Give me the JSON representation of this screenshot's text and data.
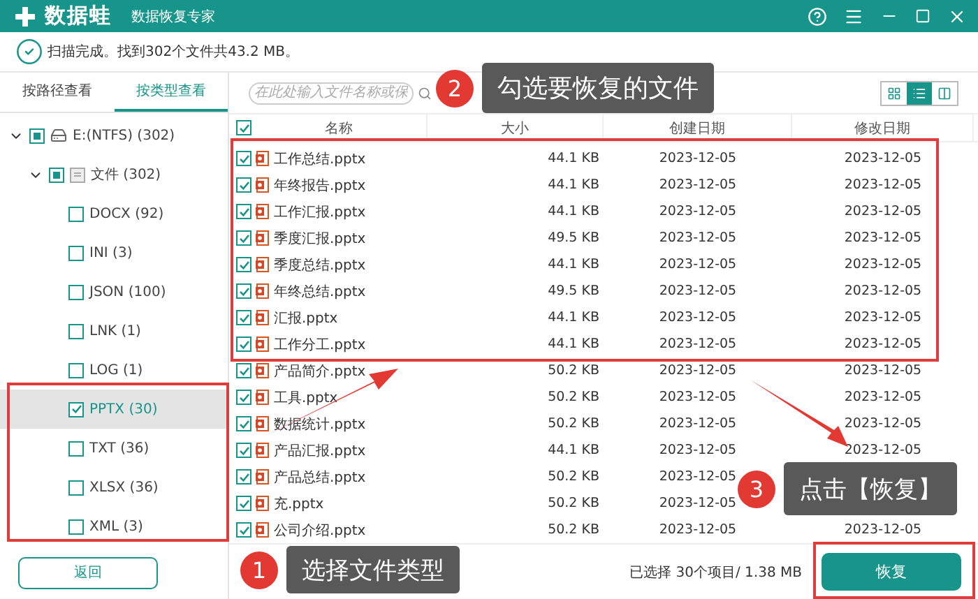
{
  "title_bar": {
    "app_name": "数据蛙",
    "subtitle": "数据恢复专家"
  },
  "status": "扫描完成。找到302个文件共43.2 MB。",
  "view_tabs": [
    {
      "label": "按路径查看",
      "selected": false
    },
    {
      "label": "按类型查看",
      "selected": true
    }
  ],
  "tree": [
    {
      "label": "E:(NTFS) (302)",
      "kind": "drive",
      "expanded": true,
      "partial": true,
      "selected": false,
      "children": [
        {
          "label": "文件 (302)",
          "kind": "folder",
          "expanded": true,
          "partial": true,
          "selected": false,
          "children": [
            {
              "label": "DOCX (92)",
              "checked": false,
              "selected": false
            },
            {
              "label": "INI (3)",
              "checked": false,
              "selected": false
            },
            {
              "label": "JSON (100)",
              "checked": false,
              "selected": false
            },
            {
              "label": "LNK (1)",
              "checked": false,
              "selected": false
            },
            {
              "label": "LOG (1)",
              "checked": false,
              "selected": false
            },
            {
              "label": "PPTX (30)",
              "checked": true,
              "selected": true
            },
            {
              "label": "TXT (36)",
              "checked": false,
              "selected": false
            },
            {
              "label": "XLSX (36)",
              "checked": false,
              "selected": false
            },
            {
              "label": "XML (3)",
              "checked": false,
              "selected": false
            }
          ]
        }
      ]
    }
  ],
  "search": {
    "placeholder": "在此处输入文件名称或保"
  },
  "view_modes": [
    {
      "kind": "grid",
      "selected": false
    },
    {
      "kind": "list",
      "selected": true
    },
    {
      "kind": "detail",
      "selected": false
    }
  ],
  "table": {
    "header_checked": true,
    "columns": [
      "名称",
      "大小",
      "创建日期",
      "修改日期"
    ],
    "rows": [
      {
        "name": "工作总结.pptx",
        "size": "44.1 KB",
        "created": "2023-12-05",
        "modified": "2023-12-05",
        "checked": true
      },
      {
        "name": "年终报告.pptx",
        "size": "44.1 KB",
        "created": "2023-12-05",
        "modified": "2023-12-05",
        "checked": true
      },
      {
        "name": "工作汇报.pptx",
        "size": "44.1 KB",
        "created": "2023-12-05",
        "modified": "2023-12-05",
        "checked": true
      },
      {
        "name": "季度汇报.pptx",
        "size": "49.5 KB",
        "created": "2023-12-05",
        "modified": "2023-12-05",
        "checked": true
      },
      {
        "name": "季度总结.pptx",
        "size": "44.1 KB",
        "created": "2023-12-05",
        "modified": "2023-12-05",
        "checked": true
      },
      {
        "name": "年终总结.pptx",
        "size": "49.5 KB",
        "created": "2023-12-05",
        "modified": "2023-12-05",
        "checked": true
      },
      {
        "name": "汇报.pptx",
        "size": "44.1 KB",
        "created": "2023-12-05",
        "modified": "2023-12-05",
        "checked": true
      },
      {
        "name": "工作分工.pptx",
        "size": "44.1 KB",
        "created": "2023-12-05",
        "modified": "2023-12-05",
        "checked": true
      },
      {
        "name": "产品简介.pptx",
        "size": "50.2 KB",
        "created": "2023-12-05",
        "modified": "2023-12-05",
        "checked": true
      },
      {
        "name": "工具.pptx",
        "size": "50.2 KB",
        "created": "2023-12-05",
        "modified": "2023-12-05",
        "checked": true
      },
      {
        "name": "数据统计.pptx",
        "size": "50.2 KB",
        "created": "2023-12-05",
        "modified": "2023-12-05",
        "checked": true
      },
      {
        "name": "产品汇报.pptx",
        "size": "44.1 KB",
        "created": "2023-12-05",
        "modified": "2023-12-05",
        "checked": true
      },
      {
        "name": "产品总结.pptx",
        "size": "50.2 KB",
        "created": "2023-12-05",
        "checked": true
      },
      {
        "name": "充.pptx",
        "size": "50.2 KB",
        "created": "2023-12-05",
        "checked": true
      },
      {
        "name": "公司介绍.pptx",
        "size": "50.2 KB",
        "created": "2023-12-05",
        "modified": "2023-12-05",
        "checked": true
      }
    ]
  },
  "footer": {
    "back_button": "返回",
    "selection": "已选择 30个项目/ 1.38 MB",
    "recover_button": "恢复"
  },
  "callouts": [
    {
      "number": "2",
      "text": "勾选要恢复的文件"
    },
    {
      "number": "3",
      "text": "点击【恢复】"
    },
    {
      "number": "1",
      "text": "选择文件类型"
    }
  ]
}
